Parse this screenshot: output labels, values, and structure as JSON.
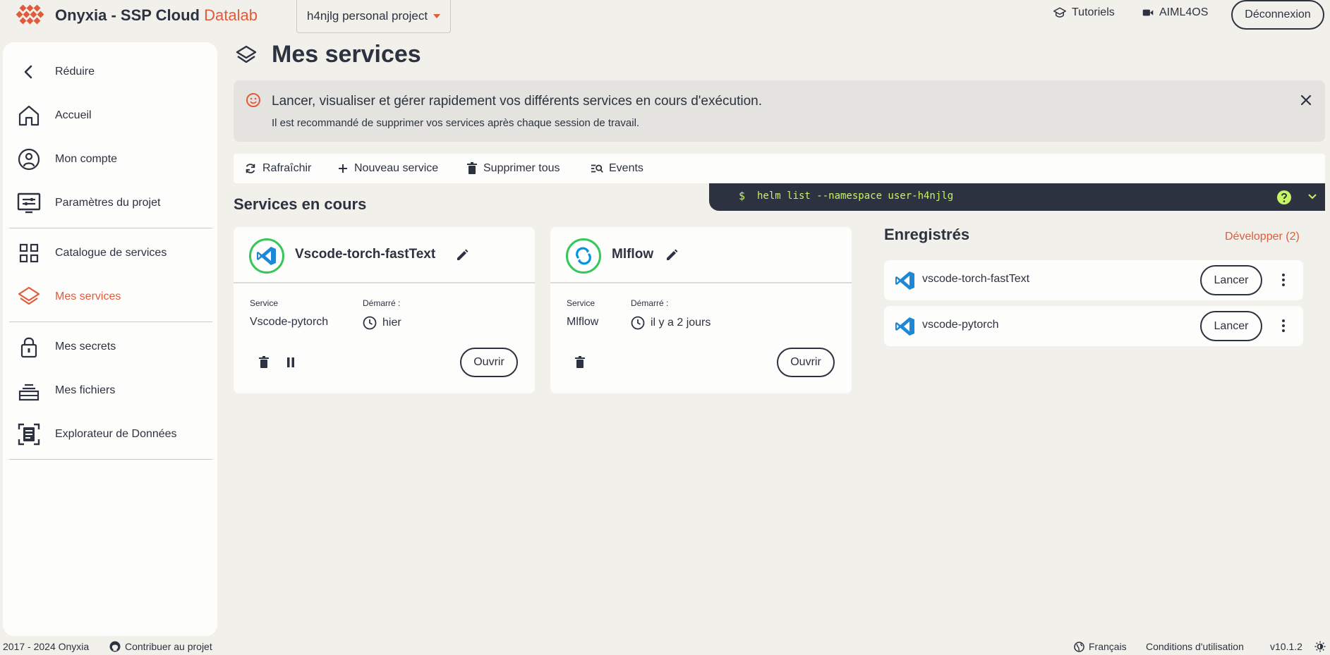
{
  "header": {
    "brand": "Onyxia - SSP Cloud",
    "brand_accent": "Datalab",
    "project": "h4njlg personal project",
    "tutorials": "Tutoriels",
    "aiml": "AIML4OS",
    "logout": "Déconnexion"
  },
  "sidebar": {
    "items": [
      {
        "label": "Réduire",
        "icon": "chevron-left-icon"
      },
      {
        "label": "Accueil",
        "icon": "home-icon"
      },
      {
        "label": "Mon compte",
        "icon": "account-icon"
      },
      {
        "label": "Paramètres du projet",
        "icon": "project-settings-icon"
      },
      {
        "label": "Catalogue de services",
        "icon": "grid-icon"
      },
      {
        "label": "Mes services",
        "icon": "layers-icon",
        "active": true
      },
      {
        "label": "Mes secrets",
        "icon": "lock-icon"
      },
      {
        "label": "Mes fichiers",
        "icon": "storage-icon"
      },
      {
        "label": "Explorateur de Données",
        "icon": "data-explorer-icon"
      }
    ]
  },
  "main": {
    "title": "Mes services",
    "banner": {
      "title": "Lancer, visualiser et gérer rapidement vos différents services en cours d'exécution.",
      "subtitle": "Il est recommandé de supprimer vos services après chaque session de travail."
    },
    "toolbar": {
      "refresh": "Rafraîchir",
      "new_service": "Nouveau service",
      "delete_all": "Supprimer tous",
      "events": "Events"
    },
    "terminal": {
      "prompt": "$",
      "command": "helm list --namespace user-h4njlg"
    },
    "running_title": "Services en cours",
    "cards": [
      {
        "name": "Vscode-torch-fastText",
        "service_label": "Service",
        "service": "Vscode-pytorch",
        "started_label": "Démarré :",
        "started": "hier",
        "open": "Ouvrir"
      },
      {
        "name": "Mlflow",
        "service_label": "Service",
        "service": "Mlflow",
        "started_label": "Démarré :",
        "started": "il y a 2 jours",
        "open": "Ouvrir"
      }
    ],
    "saved": {
      "title": "Enregistrés",
      "expand": "Développer (2)",
      "items": [
        {
          "name": "vscode-torch-fastText",
          "launch": "Lancer"
        },
        {
          "name": "vscode-pytorch",
          "launch": "Lancer"
        }
      ]
    }
  },
  "footer": {
    "copyright": "2017 - 2024 Onyxia",
    "contribute": "Contribuer au projet",
    "language": "Français",
    "terms": "Conditions d'utilisation",
    "version": "v10.1.2"
  },
  "colors": {
    "accent": "#e35a3a",
    "text": "#2c323f",
    "background": "#f1f0eb",
    "terminal_text": "#c7f464",
    "running_ring": "#35c759"
  }
}
